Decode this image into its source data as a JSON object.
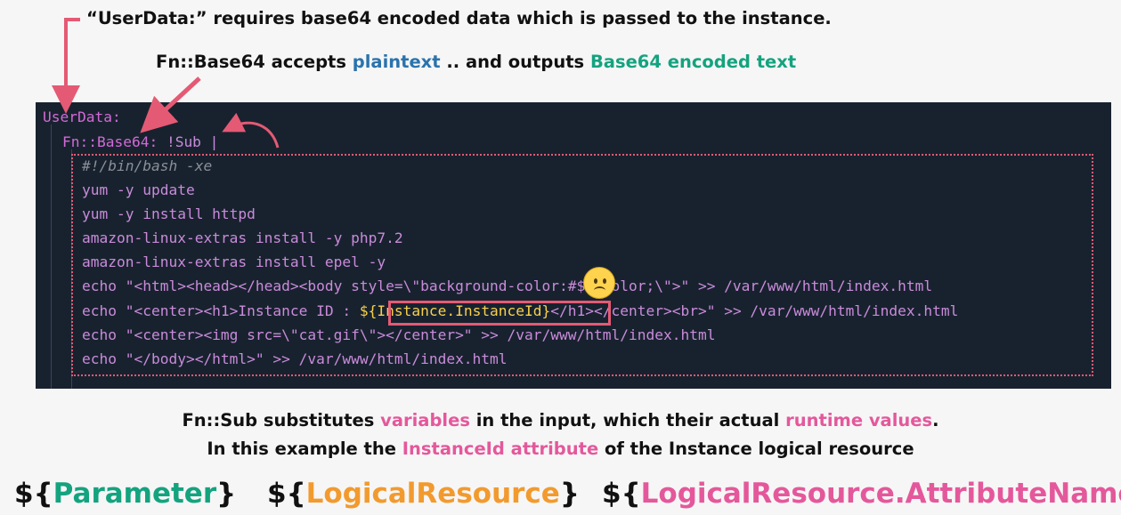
{
  "headings": {
    "line1": "“UserData:” requires base64 encoded data which is passed to the instance.",
    "line2_prefix": "Fn::Base64 accepts ",
    "line2_plaintext": "plaintext",
    "line2_mid": " .. and outputs ",
    "line2_encoded": "Base64 encoded text"
  },
  "code": {
    "userdata": "UserData:",
    "fn_key": "Fn::Base64:",
    "fn_value": " !Sub |",
    "lines": [
      "#!/bin/bash -xe",
      "yum -y update",
      "yum -y install httpd",
      "amazon-linux-extras install -y php7.2",
      "amazon-linux-extras install epel -y",
      "echo \"<html><head></head><body style=\\\"background-color:#$bgcolor;\\\">\" >> /var/www/html/index.html"
    ],
    "line7_prefix": "echo \"<center><h1>Instance ID : ",
    "line7_var": "${Instance.InstanceId}",
    "line7_suffix": "</h1></center><br>\" >> /var/www/html/index.html",
    "line8": "echo \"<center><img src=\\\"cat.gif\\\"></center>\" >> /var/www/html/index.html",
    "line9": "echo \"</body></html>\" >> /var/www/html/index.html"
  },
  "notes": {
    "line1_a": "Fn::Sub substitutes ",
    "line1_variables": "variables",
    "line1_b": " in the input, which their actual ",
    "line1_runtime": "runtime values",
    "line1_c": ".",
    "line2_a": "In this example the ",
    "line2_attr": "InstanceId attribute",
    "line2_b": " of the Instance logical resource"
  },
  "examples": {
    "open": "${",
    "close": "}",
    "parameter": "Parameter",
    "logical_resource": "LogicalResource",
    "attribute_name": "LogicalResource.AttributeName"
  },
  "colors": {
    "plaintext": "#2a73ad",
    "encoded": "#14a37f",
    "variables": "#e4589b",
    "logical_resource": "#f29a2e",
    "annotation": "#e45a74",
    "code_background": "#18222f"
  },
  "icons": [
    "sad-face-emoji-icon",
    "arrow-icon"
  ]
}
